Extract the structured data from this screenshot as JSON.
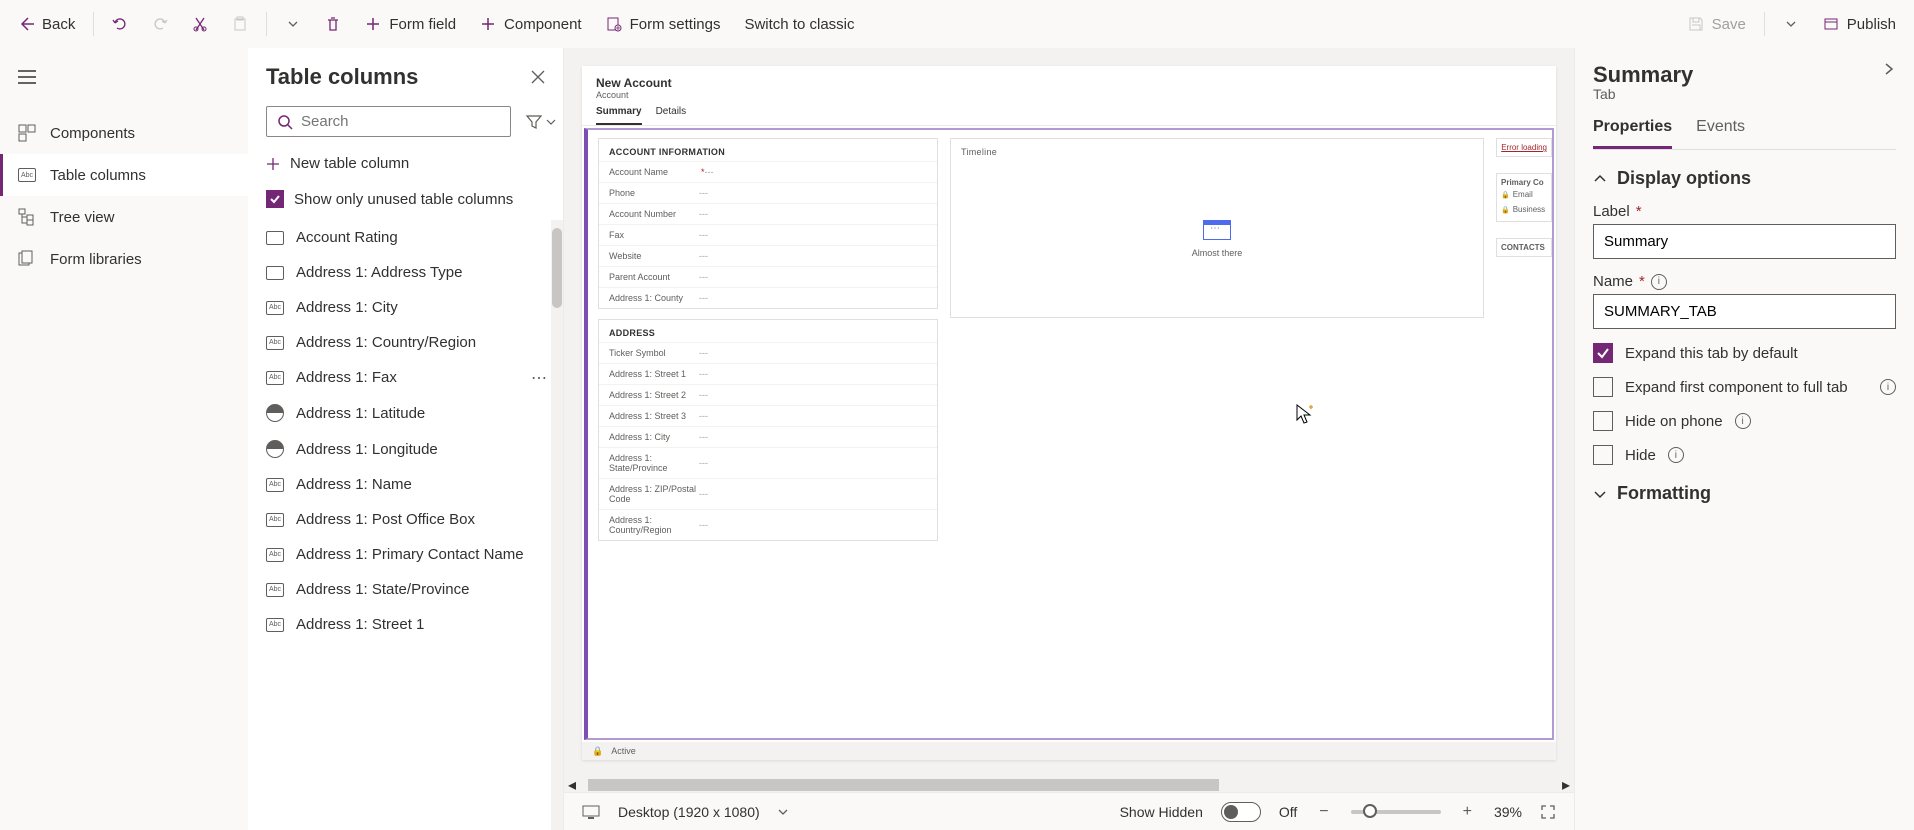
{
  "toolbar": {
    "back": "Back",
    "form_field": "Form field",
    "component": "Component",
    "form_settings": "Form settings",
    "switch_classic": "Switch to classic",
    "save": "Save",
    "publish": "Publish"
  },
  "rail": {
    "components": "Components",
    "table_columns": "Table columns",
    "tree_view": "Tree view",
    "form_libraries": "Form libraries"
  },
  "cols_panel": {
    "title": "Table columns",
    "search_placeholder": "Search",
    "new_column": "New table column",
    "show_unused": "Show only unused table columns",
    "items": [
      {
        "label": "Account Rating",
        "icon": "box"
      },
      {
        "label": "Address 1: Address Type",
        "icon": "box"
      },
      {
        "label": "Address 1: City",
        "icon": "abc"
      },
      {
        "label": "Address 1: Country/Region",
        "icon": "abc"
      },
      {
        "label": "Address 1: Fax",
        "icon": "abc"
      },
      {
        "label": "Address 1: Latitude",
        "icon": "round"
      },
      {
        "label": "Address 1: Longitude",
        "icon": "round"
      },
      {
        "label": "Address 1: Name",
        "icon": "abc"
      },
      {
        "label": "Address 1: Post Office Box",
        "icon": "abc"
      },
      {
        "label": "Address 1: Primary Contact Name",
        "icon": "abc"
      },
      {
        "label": "Address 1: State/Province",
        "icon": "abc"
      },
      {
        "label": "Address 1: Street 1",
        "icon": "abc"
      }
    ]
  },
  "canvas": {
    "form_title": "New Account",
    "form_subtitle": "Account",
    "tabs": {
      "summary": "Summary",
      "details": "Details"
    },
    "section_account_info": "ACCOUNT INFORMATION",
    "section_address": "ADDRESS",
    "timeline": "Timeline",
    "almost_there": "Almost there",
    "error_loading": "Error loading",
    "primary_contact": "Primary Co",
    "email_lbl": "Email",
    "business_lbl": "Business",
    "contacts": "CONTACTS",
    "status_active": "Active",
    "account_fields": [
      {
        "label": "Account Name",
        "required": true
      },
      {
        "label": "Phone"
      },
      {
        "label": "Account Number"
      },
      {
        "label": "Fax"
      },
      {
        "label": "Website"
      },
      {
        "label": "Parent Account"
      },
      {
        "label": "Address 1: County"
      }
    ],
    "address_fields": [
      {
        "label": "Ticker Symbol"
      },
      {
        "label": "Address 1: Street 1"
      },
      {
        "label": "Address 1: Street 2"
      },
      {
        "label": "Address 1: Street 3"
      },
      {
        "label": "Address 1: City"
      },
      {
        "label": "Address 1: State/Province"
      },
      {
        "label": "Address 1: ZIP/Postal Code"
      },
      {
        "label": "Address 1: Country/Region"
      }
    ]
  },
  "bottom": {
    "device": "Desktop (1920 x 1080)",
    "show_hidden": "Show Hidden",
    "off": "Off",
    "zoom": "39%"
  },
  "props": {
    "title": "Summary",
    "subtitle": "Tab",
    "tab_properties": "Properties",
    "tab_events": "Events",
    "display_options": "Display options",
    "label": "Label",
    "label_value": "Summary",
    "name": "Name",
    "name_value": "SUMMARY_TAB",
    "expand_default": "Expand this tab by default",
    "expand_first": "Expand first component to full tab",
    "hide_phone": "Hide on phone",
    "hide": "Hide",
    "formatting": "Formatting"
  }
}
